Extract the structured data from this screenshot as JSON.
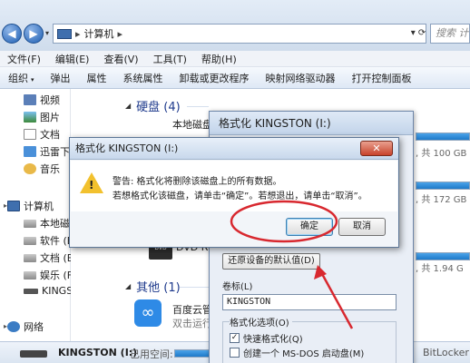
{
  "address_bar": {
    "breadcrumb_sep": "▸",
    "location": "计算机",
    "location_sep": "▸",
    "back_label": "◀",
    "forward_label": "▶",
    "dropdown_label": "▾",
    "refresh_label": "▾ ⟳",
    "search_placeholder": "搜索 计算"
  },
  "menubar": {
    "items": [
      "文件(F)",
      "编辑(E)",
      "查看(V)",
      "工具(T)",
      "帮助(H)"
    ]
  },
  "toolbar": {
    "items": [
      "组织",
      "弹出",
      "属性",
      "系统属性",
      "卸载或更改程序",
      "映射网络驱动器",
      "打开控制面板"
    ],
    "organize_dd": "▾"
  },
  "navpane": {
    "libraries": [
      "视频",
      "图片",
      "文档",
      "迅雷下载",
      "音乐"
    ],
    "computer": "计算机",
    "drives": [
      "本地磁",
      "软件 (E:",
      "文档 (E:",
      "娱乐 (F:)",
      "KINGSTON"
    ],
    "network": "网络",
    "expander": "▸"
  },
  "content": {
    "hdd_group": "硬盘 (4)",
    "other_group": "其他 (1)",
    "tri": "◢",
    "drive_names": [
      "本地磁盘",
      "",
      ""
    ],
    "drive_free": [
      ", 共 100 GB",
      ", 共 172 GB",
      ", 共 1.94 G"
    ],
    "dvd_label": "DVD RW",
    "dvd_text": "DVD",
    "baidu_name": "百度云管",
    "baidu_sub": "双击运行",
    "baidu_icon": "∞"
  },
  "format_dialog": {
    "title": "格式化 KINGSTON (I:)",
    "restore_button": "还原设备的默认值(D)",
    "volume_label": "卷标(L)",
    "volume_value": "KINGSTON",
    "options_legend": "格式化选项(O)",
    "quick_format": "快速格式化(Q)",
    "quick_format_check": "✓",
    "msdos_disk": "创建一个 MS-DOS 启动盘(M)"
  },
  "warning_dialog": {
    "title": "格式化 KINGSTON (I:)",
    "close_label": "✕",
    "icon_mark": "!",
    "line1": "警告: 格式化将删除该磁盘上的所有数据。",
    "line2": "若想格式化该磁盘，请单击“确定”。若想退出，请单击“取消”。",
    "ok_button": "确定",
    "cancel_button": "取消"
  },
  "statusbar": {
    "drive_name": "KINGSTON (I:)",
    "used_label": "已用空间:",
    "bitlocker": "BitLocker"
  },
  "colors": {
    "accent": "#1e3a8c",
    "annotation": "#d8282f",
    "drive_bar": "#1f7ac9"
  }
}
